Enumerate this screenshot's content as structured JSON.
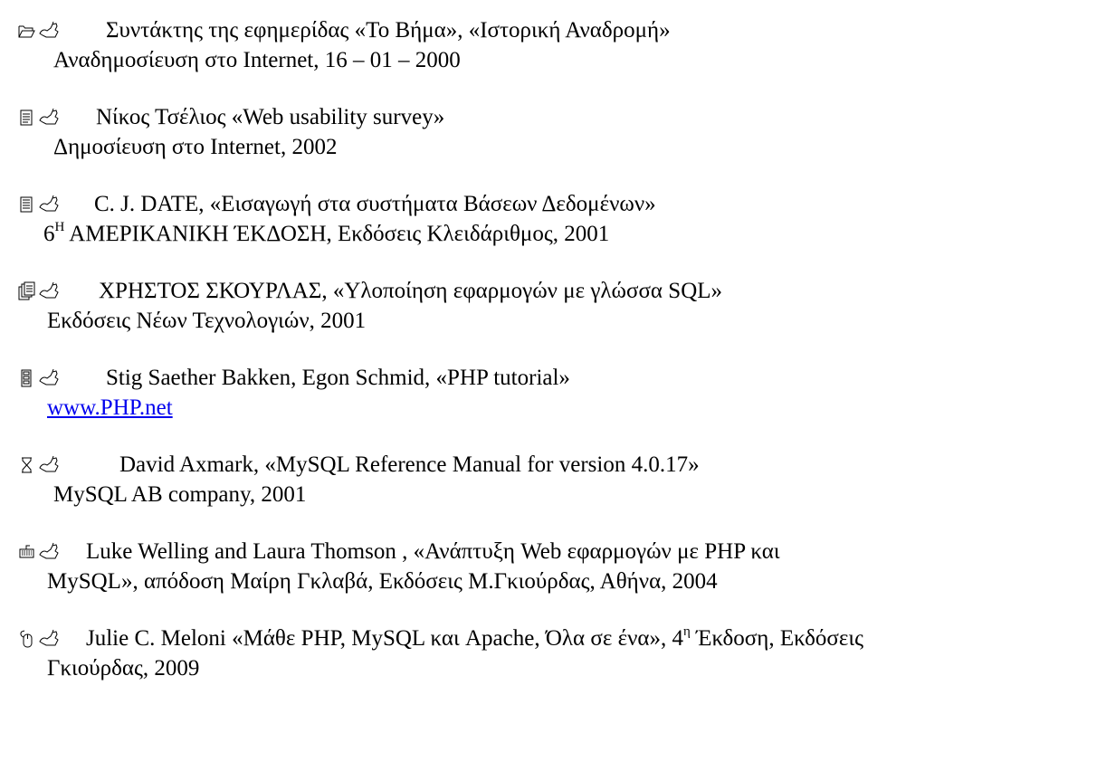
{
  "entries": [
    {
      "icon": "folder-open-icon",
      "line1": "Συντάκτης της εφημερίδας «Το Βήμα», «Ιστορική Αναδρομή»",
      "line2": "Αναδημοσίευση στο Internet, 16 – 01 – 2000"
    },
    {
      "icon": "document-icon",
      "line1": "Νίκος Τσέλιος «Web usability survey»",
      "line2": "Δημοσίευση στο Internet, 2002"
    },
    {
      "icon": "text-document-icon",
      "line1": "C. J. DATE, «Εισαγωγή στα συστήματα Βάσεων Δεδομένων»",
      "line2_prefix": "6",
      "line2_sup": "Η",
      "line2_rest": " ΑΜΕΡΙΚΑΝΙΚΗ ΈΚΔΟΣΗ, Εκδόσεις Κλειδάριθμος, 2001"
    },
    {
      "icon": "stacked-documents-icon",
      "line1": "ΧΡΗΣΤΟΣ ΣΚΟΥΡΛΑΣ, «Υλοποίηση εφαρμογών με γλώσσα SQL»",
      "line2": "Εκδόσεις Νέων Τεχνολογιών, 2001"
    },
    {
      "icon": "filing-cabinet-icon",
      "line1": "Stig Saether Bakken, Egon Schmid, «PHP tutorial»",
      "link": "www.PHP.net"
    },
    {
      "icon": "hourglass-icon",
      "line1": "David Axmark, «MySQL Reference Manual for version 4.0.17»",
      "line2": "MySQL AB company, 2001"
    },
    {
      "icon": "keyboard-icon",
      "line1": "Luke Welling and Laura Thomson , «Ανάπτυξη Web εφαρμογών με PHP και",
      "line2": "MySQL», απόδοση Μαίρη Γκλαβά, Εκδόσεις Μ.Γκιούρδας, Αθήνα, 2004"
    },
    {
      "icon": "mouse-icon",
      "line1_a": "Julie C. Meloni «Μάθε PHP, MySQL και Apache, Όλα σε ένα», 4",
      "line1_sup": "η",
      "line1_b": " Έκδοση, Εκδόσεις",
      "line2": "Γκιούρδας, 2009"
    }
  ]
}
